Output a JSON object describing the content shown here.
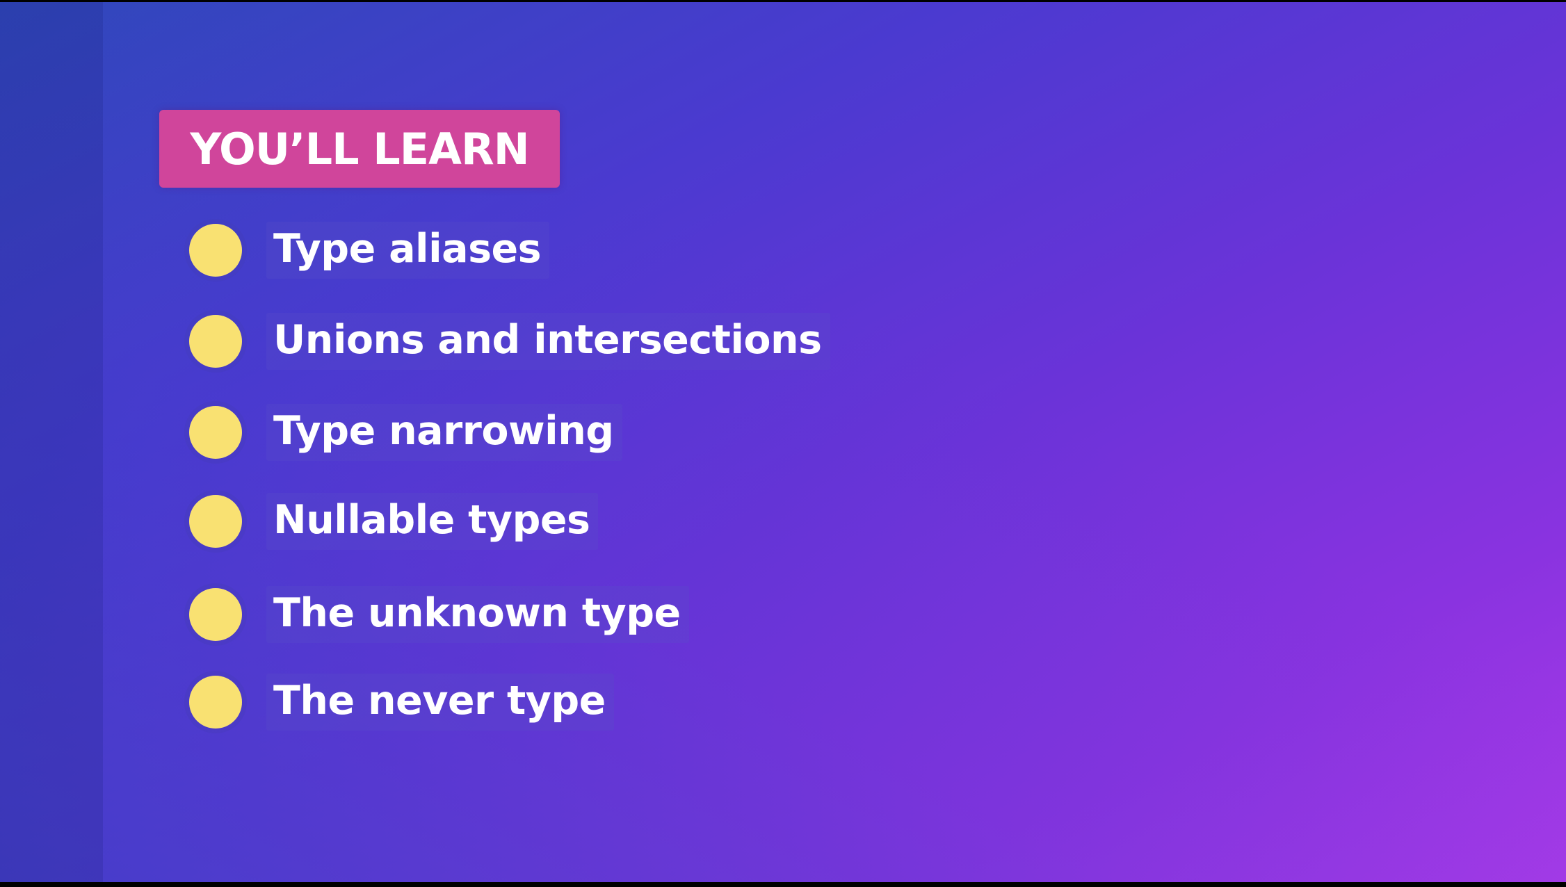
{
  "slide": {
    "heading": "YOU’LL LEARN",
    "topics": [
      "Type aliases",
      "Unions and intersections",
      "Type narrowing",
      "Nullable types",
      "The unknown type",
      "The never type"
    ]
  },
  "colors": {
    "heading_badge": "#d0459b",
    "bullet": "#f9e172",
    "text": "#ffffff",
    "background_start": "#2f48bb",
    "background_end": "#a93ae8"
  },
  "icons": {
    "bullet": "filled-circle"
  }
}
